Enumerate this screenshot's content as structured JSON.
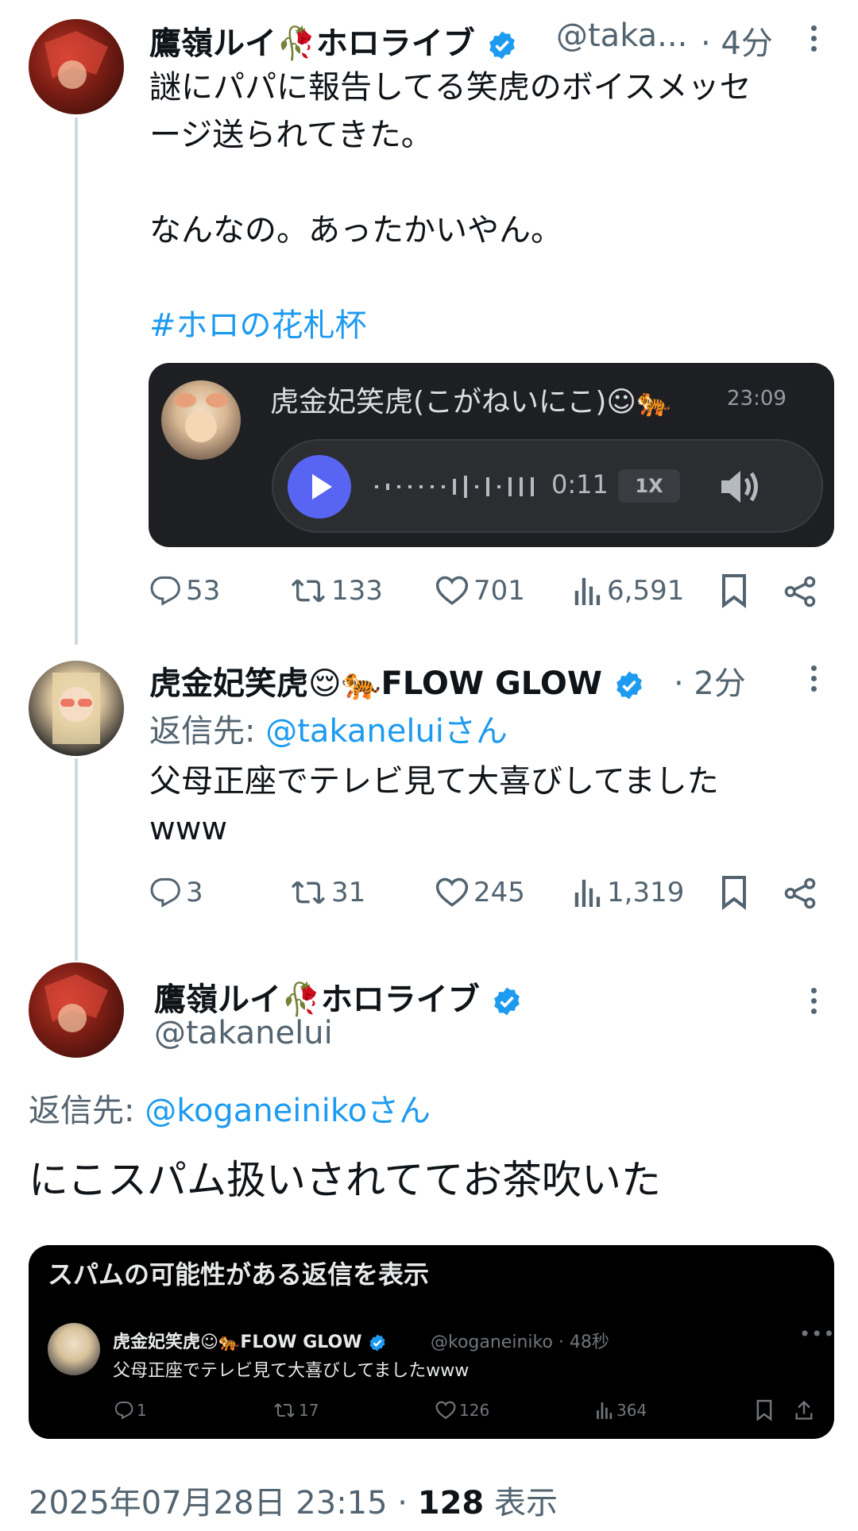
{
  "tweet1": {
    "name": "鷹嶺ルイ",
    "name_suffix": "ホロライブ",
    "handle": "@taka...",
    "time": "· 4分",
    "text_line1": "謎にパパに報告してる笑虎のボイスメッセ",
    "text_line2": "ージ送られてきた。",
    "text_line3": "なんなの。あったかいやん。",
    "hashtag": "#ホロの花札杯",
    "voice": {
      "sender": "虎金妃笑虎(こがねいにこ)☺🐅",
      "time": "23:09",
      "duration": "0:11",
      "speed": "1X"
    },
    "stats": {
      "replies": "53",
      "retweets": "133",
      "likes": "701",
      "views": "6,591"
    }
  },
  "tweet2": {
    "name": "虎金妃笑虎😌🐅FLOW GLOW",
    "time": "· 2分",
    "reply_prefix": "返信先: ",
    "reply_to": "@takaneluiさん",
    "text_line1": "父母正座でテレビ見て大喜びしてました",
    "text_line2": "www",
    "stats": {
      "replies": "3",
      "retweets": "31",
      "likes": "245",
      "views": "1,319"
    }
  },
  "tweet3": {
    "name": "鷹嶺ルイ",
    "name_suffix": "ホロライブ",
    "handle": "@takanelui",
    "reply_prefix": "返信先: ",
    "reply_to": "@koganeinikoさん",
    "text": "にこスパム扱いされててお茶吹いた",
    "embed": {
      "header": "スパムの可能性がある返信を表示",
      "name": "虎金妃笑虎☺🐅FLOW GLOW",
      "handle_time": "@koganeiniko · 48秒",
      "text": "父母正座でテレビ見て大喜びしてましたwww",
      "stats": {
        "replies": "1",
        "retweets": "17",
        "likes": "126",
        "views": "364"
      }
    },
    "timestamp": "2025年07月28日 23:15 · ",
    "views_count": "128",
    "views_label": " 表示"
  },
  "colors": {
    "link": "#1d9bf0",
    "verified": "#1d9bf0",
    "secondary": "#536471",
    "voice_bg": "#1e1f22",
    "play_button": "#5865f2"
  }
}
